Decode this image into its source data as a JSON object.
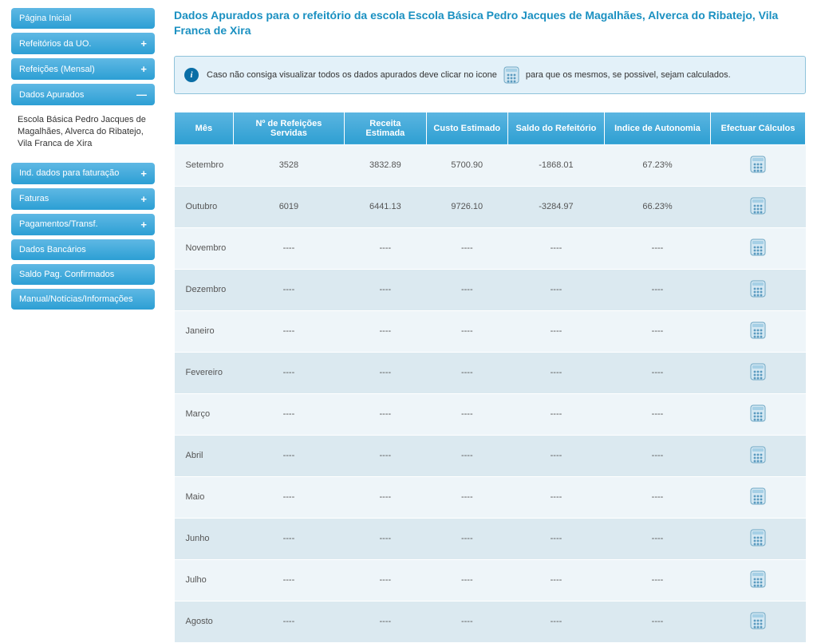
{
  "sidebar": {
    "items": [
      {
        "label": "Página Inicial",
        "toggle": ""
      },
      {
        "label": "Refeitórios da UO.",
        "toggle": "+"
      },
      {
        "label": "Refeições (Mensal)",
        "toggle": "+"
      },
      {
        "label": "Dados Apurados",
        "toggle": "—"
      },
      {
        "label": "Ind. dados para faturação",
        "toggle": "+"
      },
      {
        "label": "Faturas",
        "toggle": "+"
      },
      {
        "label": "Pagamentos/Transf.",
        "toggle": "+"
      },
      {
        "label": "Dados Bancários",
        "toggle": ""
      },
      {
        "label": "Saldo Pag. Confirmados",
        "toggle": ""
      },
      {
        "label": "Manual/Notícias/Informações",
        "toggle": ""
      }
    ],
    "submenu_under_index": 3,
    "submenu_text": "Escola Básica Pedro Jacques de Magalhães, Alverca do Ribatejo, Vila Franca de Xira"
  },
  "page_title": "Dados Apurados para o refeitório da escola Escola Básica Pedro Jacques de Magalhães, Alverca do Ribatejo, Vila Franca de Xira",
  "info": {
    "text_before_icon": "Caso não consiga visualizar todos os dados apurados deve clicar no icone",
    "text_after_icon": "para que os mesmos, se possivel, sejam calculados."
  },
  "table": {
    "headers": {
      "mes": "Mês",
      "num": "Nº de Refeições Servidas",
      "receita": "Receita Estimada",
      "custo": "Custo Estimado",
      "saldo": "Saldo do Refeitório",
      "indice": "Indice de Autonomia",
      "act": "Efectuar Cálculos"
    },
    "rows": [
      {
        "mes": "Setembro",
        "num": "3528",
        "receita": "3832.89",
        "custo": "5700.90",
        "saldo": "-1868.01",
        "indice": "67.23%"
      },
      {
        "mes": "Outubro",
        "num": "6019",
        "receita": "6441.13",
        "custo": "9726.10",
        "saldo": "-3284.97",
        "indice": "66.23%"
      },
      {
        "mes": "Novembro",
        "num": "----",
        "receita": "----",
        "custo": "----",
        "saldo": "----",
        "indice": "----"
      },
      {
        "mes": "Dezembro",
        "num": "----",
        "receita": "----",
        "custo": "----",
        "saldo": "----",
        "indice": "----"
      },
      {
        "mes": "Janeiro",
        "num": "----",
        "receita": "----",
        "custo": "----",
        "saldo": "----",
        "indice": "----"
      },
      {
        "mes": "Fevereiro",
        "num": "----",
        "receita": "----",
        "custo": "----",
        "saldo": "----",
        "indice": "----"
      },
      {
        "mes": "Março",
        "num": "----",
        "receita": "----",
        "custo": "----",
        "saldo": "----",
        "indice": "----"
      },
      {
        "mes": "Abril",
        "num": "----",
        "receita": "----",
        "custo": "----",
        "saldo": "----",
        "indice": "----"
      },
      {
        "mes": "Maio",
        "num": "----",
        "receita": "----",
        "custo": "----",
        "saldo": "----",
        "indice": "----"
      },
      {
        "mes": "Junho",
        "num": "----",
        "receita": "----",
        "custo": "----",
        "saldo": "----",
        "indice": "----"
      },
      {
        "mes": "Julho",
        "num": "----",
        "receita": "----",
        "custo": "----",
        "saldo": "----",
        "indice": "----"
      },
      {
        "mes": "Agosto",
        "num": "----",
        "receita": "----",
        "custo": "----",
        "saldo": "----",
        "indice": "----"
      }
    ]
  }
}
